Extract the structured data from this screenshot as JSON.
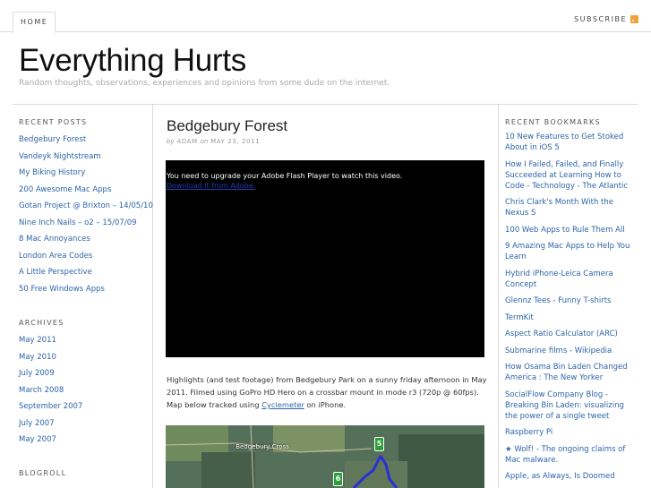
{
  "nav": {
    "home_label": "Home",
    "subscribe_label": "Subscribe"
  },
  "site": {
    "title": "Everything Hurts",
    "tagline": "Random thoughts, observations, experiences and opinions from some dude on the internet."
  },
  "recent_posts": {
    "title": "Recent Posts",
    "items": [
      "Bedgebury Forest",
      "Vandeyk Nightstream",
      "My Biking History",
      "200 Awesome Mac Apps",
      "Gotan Project @ Brixton – 14/05/10",
      "Nine Inch Nails – o2 – 15/07/09",
      "8 Mac Annoyances",
      "London Area Codes",
      "A Little Perspective",
      "50 Free Windows Apps"
    ]
  },
  "archives": {
    "title": "Archives",
    "items": [
      "May 2011",
      "May 2010",
      "July 2009",
      "March 2008",
      "September 2007",
      "July 2007",
      "May 2007"
    ]
  },
  "blogroll": {
    "title": "Blogroll"
  },
  "post": {
    "title": "Bedgebury Forest",
    "by": "by",
    "author": "Adam",
    "on": "on",
    "date": "May 23, 2011",
    "flash_message": "You need to upgrade your Adobe Flash Player to watch this video.",
    "flash_link": "Download it from Adobe.",
    "body_before_link": "Highlights (and test footage) from Bedgebury Park on a sunny friday afternoon in May 2011. Filmed using GoPro HD Hero on a crossbar mount in mode r3 (720p @ 60fps). Map below tracked using ",
    "body_link": "Cyclemeter",
    "body_after_link": " on iPhone.",
    "map_label": "Bedgebury Cross",
    "map_markers": [
      "5",
      "6"
    ]
  },
  "bookmarks": {
    "title": "Recent Bookmarks",
    "items": [
      "10 New Features to Get Stoked About in iOS 5",
      "How I Failed, Failed, and Finally Succeeded at Learning How to Code - Technology - The Atlantic",
      "Chris Clark's Month With the Nexus S",
      "100 Web Apps to Rule Them All",
      "9 Amazing Mac Apps to Help You Learn",
      "Hybrid iPhone-Leica Camera Concept",
      "Glennz Tees - Funny T-shirts",
      "TermKit",
      "Aspect Ratio Calculator (ARC)",
      "Submarine films - Wikipedia",
      "How Osama Bin Laden Changed America : The New Yorker",
      "SocialFlow Company Blog - Breaking Bin Laden: visualizing the power of a single tweet",
      "Raspberry Pi",
      "★ Wolf! - The ongoing claims of Mac malware.",
      "Apple, as Always, Is Doomed"
    ]
  },
  "colors": {
    "link": "#2d64a8",
    "rss": "#f2a03a",
    "map_marker": "#2e9e3a",
    "map_route": "#2a2fd6"
  }
}
